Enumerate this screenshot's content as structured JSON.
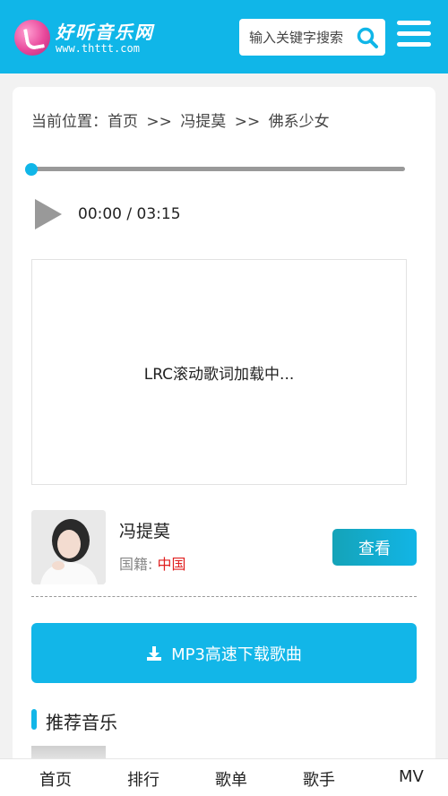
{
  "header": {
    "logo_title": "好听音乐网",
    "logo_url": "www.thttt.com",
    "search_placeholder": "输入关键字搜索",
    "brand_color": "#10b6e8"
  },
  "breadcrumb": {
    "prefix": "当前位置：",
    "home": "首页",
    "sep1": ">>",
    "artist": "冯提莫",
    "sep2": ">>",
    "song": "佛系少女"
  },
  "player": {
    "progress": 0,
    "current_time": "00:00",
    "time_sep": " / ",
    "duration": "03:15",
    "play_icon": "play-icon"
  },
  "lyrics": {
    "status": "LRC滚动歌词加载中..."
  },
  "artist": {
    "name": "冯提莫",
    "nation_label": "国籍: ",
    "nation": "中国",
    "view_label": "查看"
  },
  "download": {
    "label": "MP3高速下载歌曲",
    "icon": "download-icon"
  },
  "recommend": {
    "title": "推荐音乐"
  },
  "bottom_nav": {
    "items": [
      "首页",
      "排行",
      "歌单",
      "歌手",
      "MV"
    ]
  }
}
